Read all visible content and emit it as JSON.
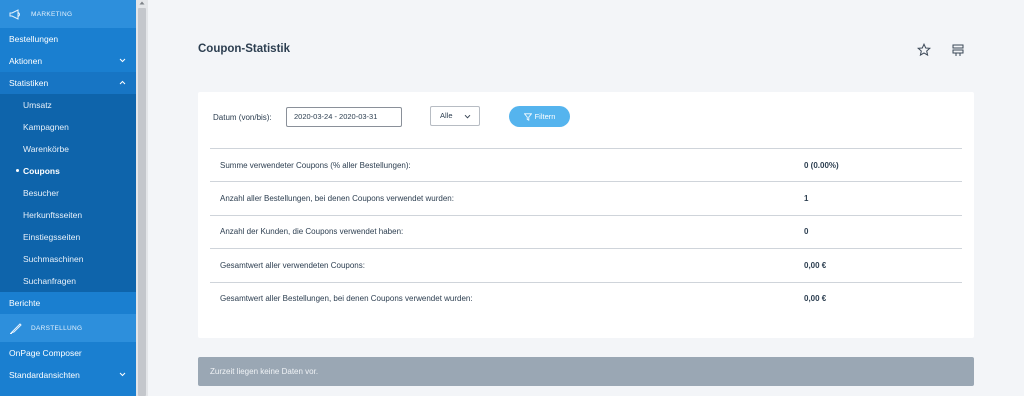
{
  "sidebar": {
    "section_marketing": "MARKETING",
    "section_darstellung": "DARSTELLUNG",
    "items": {
      "bestellungen": "Bestellungen",
      "aktionen": "Aktionen",
      "statistiken": "Statistiken",
      "berichte": "Berichte",
      "onpage": "OnPage Composer",
      "standardansichten": "Standardansichten"
    },
    "sub": {
      "umsatz": "Umsatz",
      "kampagnen": "Kampagnen",
      "warenkoerbe": "Warenkörbe",
      "coupons": "Coupons",
      "besucher": "Besucher",
      "herkunftsseiten": "Herkunftsseiten",
      "einstiegsseiten": "Einstiegsseiten",
      "suchmaschinen": "Suchmaschinen",
      "suchanfragen": "Suchanfragen"
    }
  },
  "header": {
    "title": "Coupon-Statistik"
  },
  "filter": {
    "label": "Datum (von/bis):",
    "date_value": "2020-03-24 - 2020-03-31",
    "select_value": "Alle",
    "button_label": "Filtern"
  },
  "stats": [
    {
      "label": "Summe verwendeter Coupons (% aller Bestellungen):",
      "value": "0 (0.00%)"
    },
    {
      "label": "Anzahl aller Bestellungen, bei denen Coupons verwendet wurden:",
      "value": "1"
    },
    {
      "label": "Anzahl der Kunden, die Coupons verwendet haben:",
      "value": "0"
    },
    {
      "label": "Gesamtwert aller verwendeten Coupons:",
      "value": "0,00 €"
    },
    {
      "label": "Gesamtwert aller Bestellungen, bei denen Coupons verwendet wurden:",
      "value": "0,00 €"
    }
  ],
  "notice": "Zurzeit liegen keine Daten vor.",
  "colors": {
    "sidebar": "#1a7fd0",
    "submenu": "#0e64ab",
    "accent_button": "#55b4ee",
    "notice": "#9aa7b4"
  },
  "icons": {
    "marketing": "megaphone-icon",
    "darstellung": "brush-icon",
    "favorite": "star-icon",
    "settings": "sliders-icon",
    "filter": "funnel-icon"
  }
}
